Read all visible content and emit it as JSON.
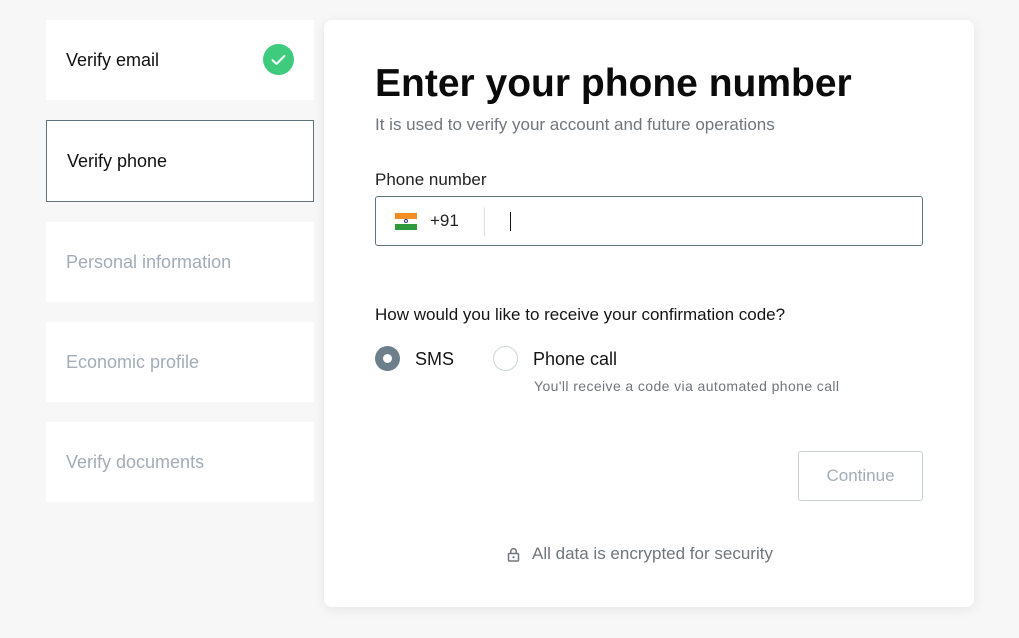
{
  "steps": [
    {
      "label": "Verify email",
      "state": "done"
    },
    {
      "label": "Verify phone",
      "state": "active"
    },
    {
      "label": "Personal information",
      "state": "pending"
    },
    {
      "label": "Economic profile",
      "state": "pending"
    },
    {
      "label": "Verify documents",
      "state": "pending"
    }
  ],
  "main": {
    "title": "Enter your phone number",
    "subtitle": "It is used to verify your account and future operations",
    "phone": {
      "label": "Phone number",
      "country_flag": "india-flag-icon",
      "dial_code": "+91",
      "value": "",
      "placeholder": ""
    },
    "delivery": {
      "question": "How would you like to receive your confirmation code?",
      "options": [
        {
          "label": "SMS",
          "selected": true
        },
        {
          "label": "Phone call",
          "selected": false,
          "hint": "You'll receive a code via automated phone call"
        }
      ]
    },
    "continue_label": "Continue",
    "security_note": "All data is encrypted for security"
  },
  "colors": {
    "success": "#3fcb7e",
    "border_active": "#5f7480",
    "radio_selected": "#6d7f8b",
    "muted_text": "#a3acb6"
  }
}
